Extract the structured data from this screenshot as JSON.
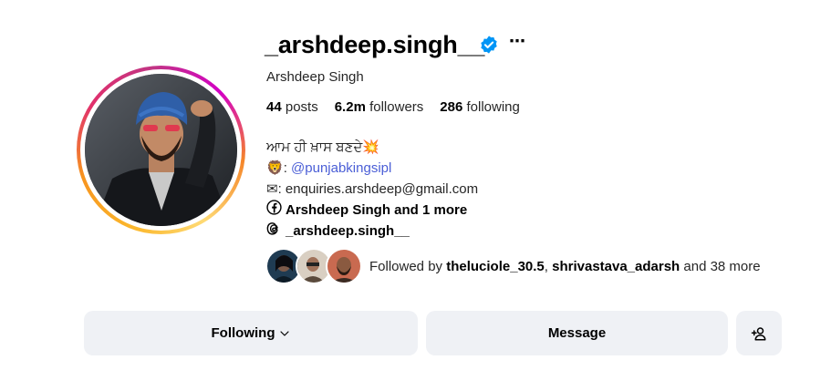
{
  "profile": {
    "username": "_arshdeep.singh__",
    "full_name": "Arshdeep Singh",
    "stats": {
      "posts_count": "44",
      "posts_label": "posts",
      "followers_count": "6.2m",
      "followers_label": "followers",
      "following_count": "286",
      "following_label": "following"
    },
    "bio": {
      "line1": "ਆਮ ਹੀ ਖ਼ਾਸ ਬਣਦੇ",
      "line1_emoji": "💥",
      "lion_emoji": "🦁",
      "mention_prefix": ":",
      "mention": "@punjabkingsipl",
      "email_emoji": "✉",
      "email_text": ": enquiries.arshdeep@gmail.com",
      "facebook_text": "Arshdeep Singh and 1 more",
      "threads_text": "_arshdeep.singh__"
    },
    "followed_by": {
      "prefix": "Followed by ",
      "user1": "theluciole_30.5",
      "separator": ", ",
      "user2": "shrivastava_adarsh",
      "suffix": " and 38 more"
    }
  },
  "actions": {
    "following_label": "Following",
    "message_label": "Message"
  },
  "icons": {
    "verified": "verified-badge-icon",
    "more": "more-options-icon",
    "facebook": "facebook-icon",
    "threads": "threads-icon",
    "chevron": "chevron-down-icon",
    "add_user": "add-user-icon"
  },
  "colors": {
    "verified": "#0095f6",
    "link": "#4a5ed6",
    "button_bg": "#eff1f5"
  }
}
